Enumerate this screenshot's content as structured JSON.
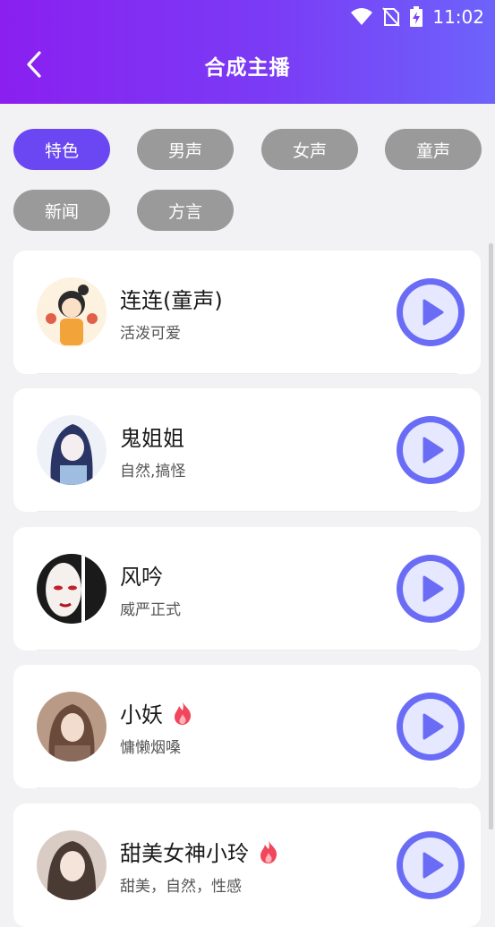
{
  "status": {
    "time": "11:02"
  },
  "header": {
    "title": "合成主播"
  },
  "filters": [
    "特色",
    "男声",
    "女声",
    "童声",
    "新闻",
    "方言"
  ],
  "active_filter": "特色",
  "anchors": [
    {
      "name": "连连(童声)",
      "desc": "活泼可爱",
      "hot": false
    },
    {
      "name": "鬼姐姐",
      "desc": "自然,搞怪",
      "hot": false
    },
    {
      "name": "风吟",
      "desc": "威严正式",
      "hot": false
    },
    {
      "name": "小妖",
      "desc": "慵懒烟嗓",
      "hot": true
    },
    {
      "name": "甜美女神小玲",
      "desc": "甜美，自然，性感",
      "hot": true
    }
  ],
  "colors": {
    "accent": "#6a47f2",
    "chip_inactive": "#9a9a9a",
    "header_start": "#8a1ff0",
    "header_end": "#6d63fb"
  }
}
